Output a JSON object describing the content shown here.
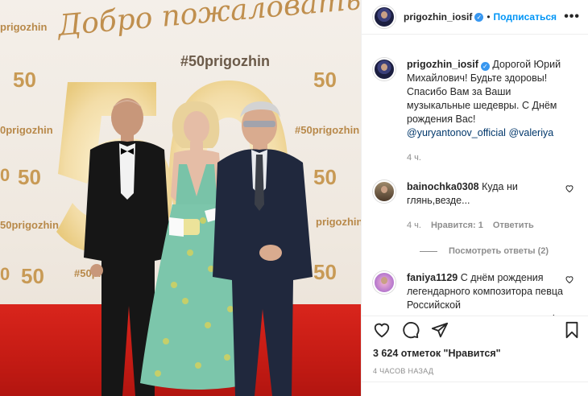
{
  "photo": {
    "welcome_text": "Добро пожаловать!",
    "hashtag": "#50prigozhin",
    "watermark_tag": "#50prigozhin",
    "watermark_number": "50",
    "tag_partial_1": "prigozhin",
    "tag_partial_2": "0prigozhin",
    "tag_partial_3": "50prigozhin",
    "tag_partial_4": "prigozhin",
    "num_partial": "0"
  },
  "header": {
    "username": "prigozhin_iosif",
    "verified": true,
    "follow_label": "Подписаться",
    "more_label": "•••"
  },
  "post": {
    "caption": {
      "username": "prigozhin_iosif",
      "text": "Дорогой Юрий Михайлович! Будьте здоровы! Спасибо Вам за Ваши музыкальные шедевры. С Днём рождения Вас!",
      "mention_1": "@yuryantonov_official",
      "mention_2": "@valeriya",
      "time": "4 ч."
    },
    "comments": [
      {
        "username": "bainochka0308",
        "text": "Куда ни глянь,везде...",
        "time": "4 ч.",
        "likes": "Нравится: 1",
        "reply_label": "Ответить",
        "view_replies": "Посмотреть ответы (2)"
      },
      {
        "username": "faniya1129",
        "text": "С днём рождения легендарного композитора певца Российской эстрады,здоровья,новых хитов!",
        "emoji": "❤️🥰🎁🎉"
      }
    ],
    "likes_text": "3 624 отметок \"Нравится\"",
    "time_ago": "4 часов назад"
  },
  "colors": {
    "accent_blue": "#0095f6",
    "carpet_red": "#c41b14",
    "gold": "#c89a55"
  },
  "icons": [
    "like-icon",
    "comment-icon",
    "share-icon",
    "save-icon",
    "verified-icon",
    "heart-icon"
  ]
}
